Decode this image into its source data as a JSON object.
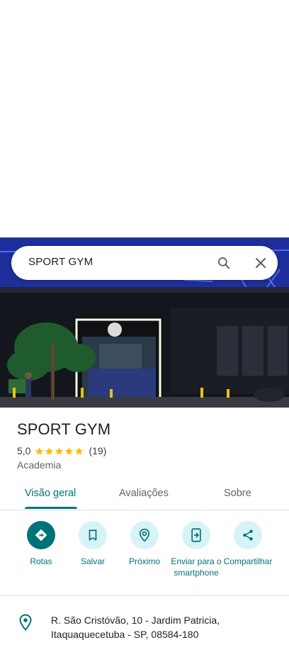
{
  "search": {
    "query": "SPORT GYM"
  },
  "place": {
    "name": "SPORT GYM",
    "rating": "5,0",
    "stars": 5,
    "reviews": "(19)",
    "category": "Academia"
  },
  "tabs": [
    {
      "label": "Visão geral",
      "active": true
    },
    {
      "label": "Avaliações",
      "active": false
    },
    {
      "label": "Sobre",
      "active": false
    }
  ],
  "actions": [
    {
      "label": "Rotas",
      "icon": "directions-icon"
    },
    {
      "label": "Salvar",
      "icon": "bookmark-icon"
    },
    {
      "label": "Próximo",
      "icon": "nearby-icon"
    },
    {
      "label": "Enviar para o smartphone",
      "icon": "send-to-phone-icon"
    },
    {
      "label": "Compartilhar",
      "icon": "share-icon"
    }
  ],
  "address": {
    "line1": "R. São Cristóvão, 10 - Jardim Patricia,",
    "line2": "Itaquaquecetuba - SP, 08584-180"
  },
  "colors": {
    "accent": "#00727a",
    "action_bg": "#d7f3f7",
    "star": "#fbbc04"
  }
}
